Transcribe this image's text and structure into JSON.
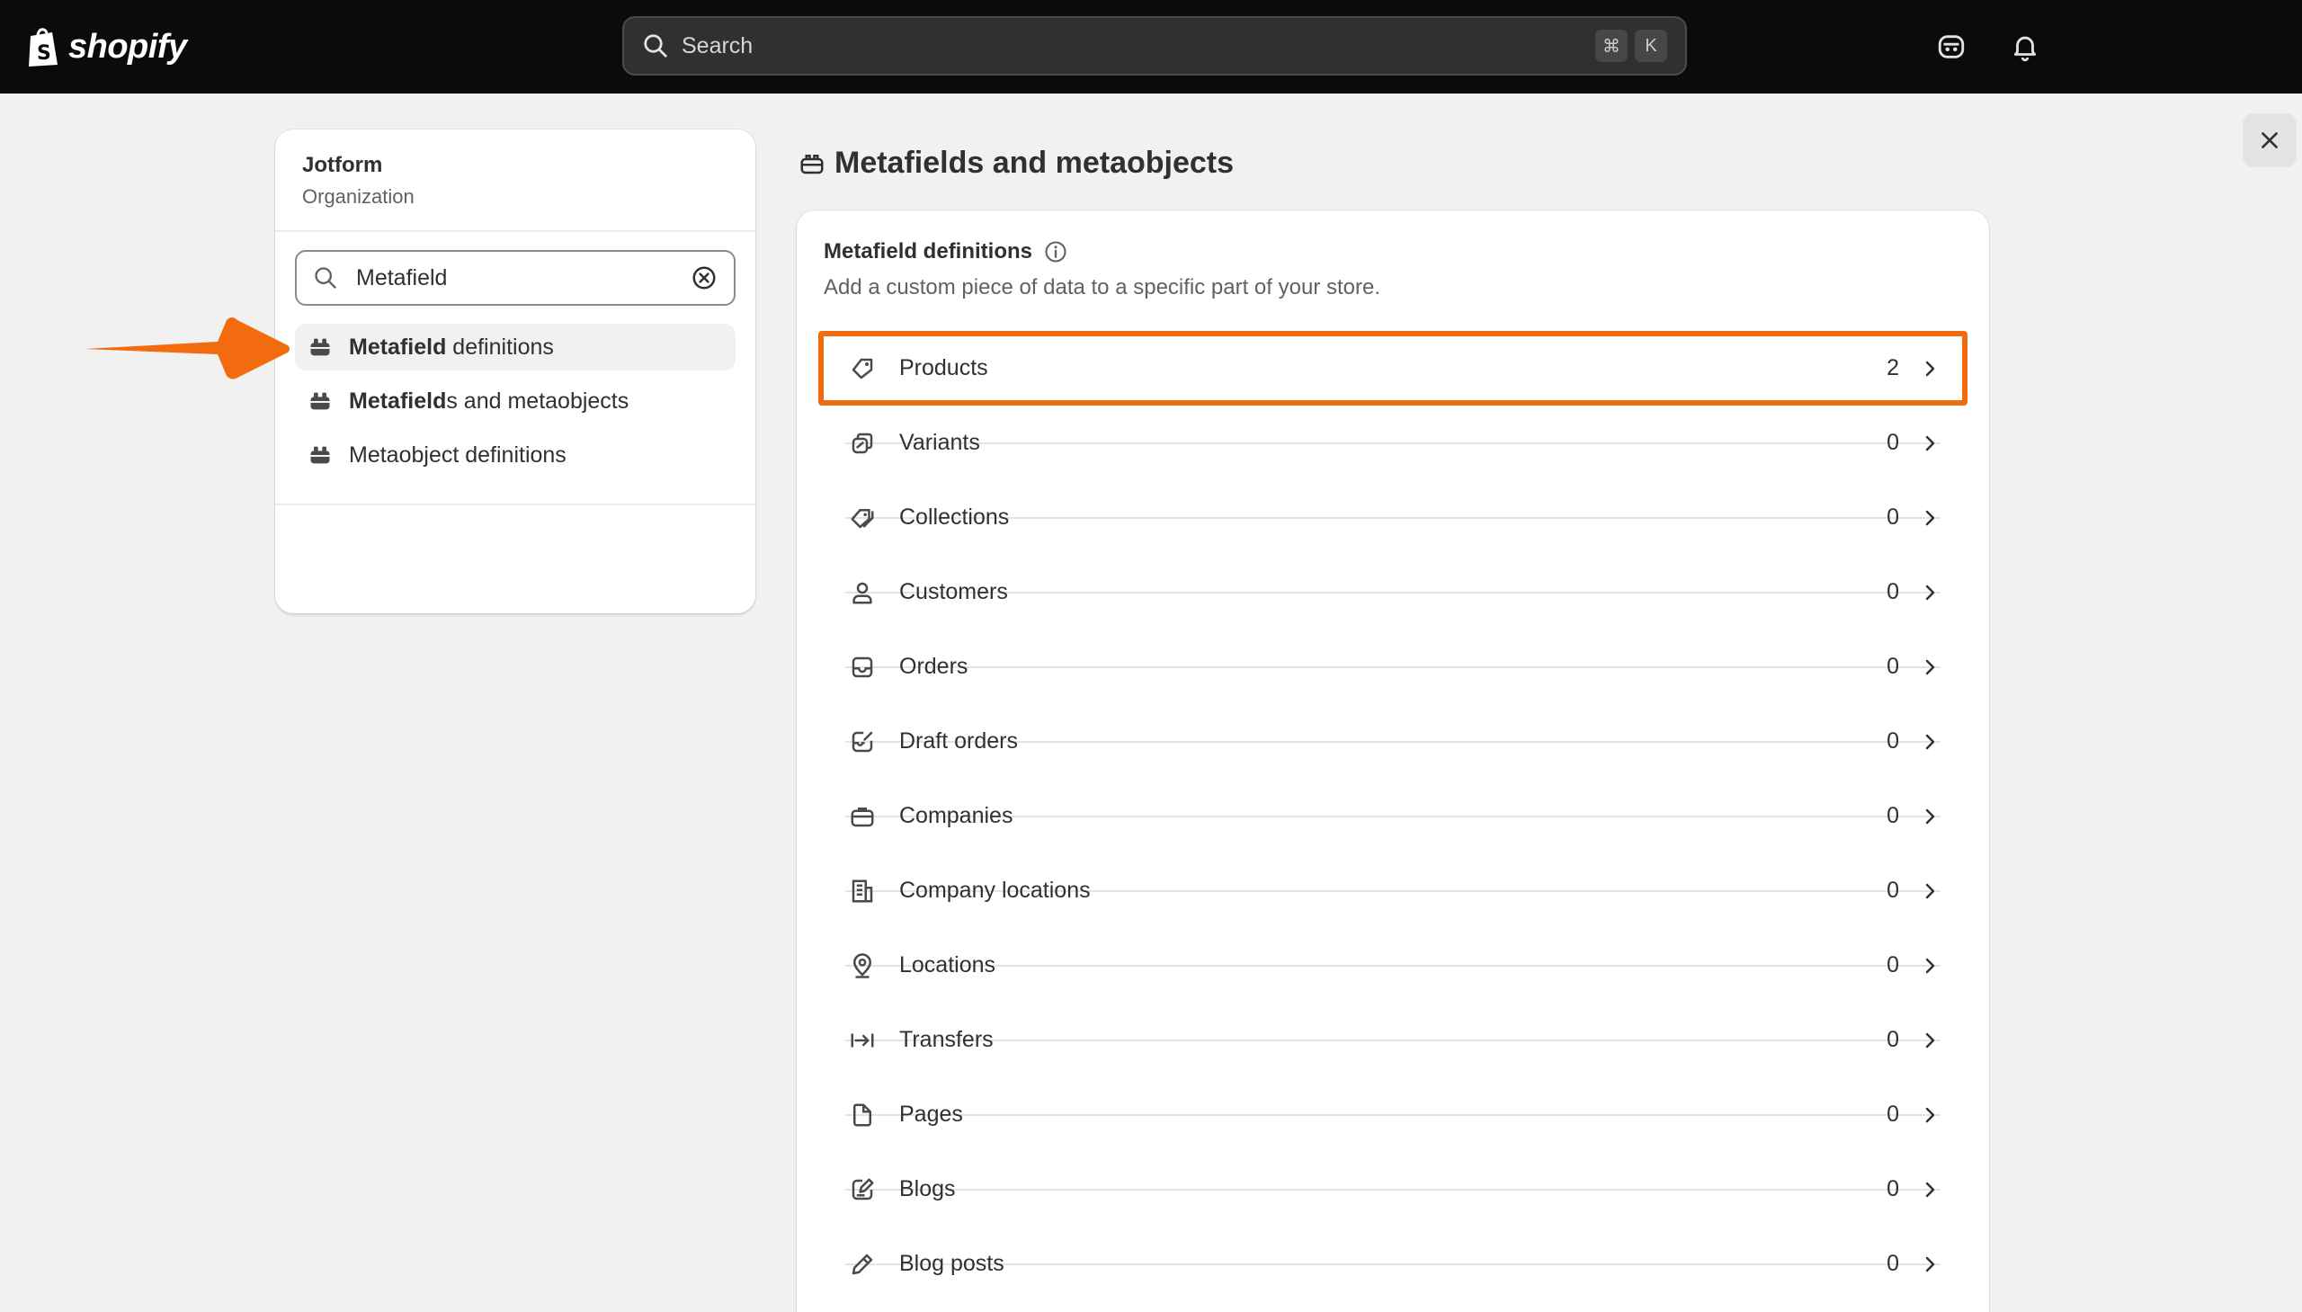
{
  "topbar": {
    "logo_text": "shopify",
    "search_placeholder": "Search",
    "shortcut_keys": [
      "⌘",
      "K"
    ]
  },
  "left_panel": {
    "org_name": "Jotform",
    "org_sub": "Organization",
    "search_value": "Metafield",
    "items": [
      {
        "bold": "Metafield",
        "rest": " definitions",
        "active": true
      },
      {
        "bold": "Metafield",
        "rest": "s and metaobjects",
        "active": false
      },
      {
        "bold": "",
        "rest": "Metaobject definitions",
        "active": false
      }
    ]
  },
  "main": {
    "page_title": "Metafields and metaobjects",
    "card_title": "Metafield definitions",
    "card_desc": "Add a custom piece of data to a specific part of your store.",
    "rows": [
      {
        "label": "Products",
        "count": "2",
        "icon": "tag-icon"
      },
      {
        "label": "Variants",
        "count": "0",
        "icon": "variants-icon"
      },
      {
        "label": "Collections",
        "count": "0",
        "icon": "collections-icon"
      },
      {
        "label": "Customers",
        "count": "0",
        "icon": "person-icon"
      },
      {
        "label": "Orders",
        "count": "0",
        "icon": "inbox-icon"
      },
      {
        "label": "Draft orders",
        "count": "0",
        "icon": "draft-order-icon"
      },
      {
        "label": "Companies",
        "count": "0",
        "icon": "briefcase-icon"
      },
      {
        "label": "Company locations",
        "count": "0",
        "icon": "building-icon"
      },
      {
        "label": "Locations",
        "count": "0",
        "icon": "location-pin-icon"
      },
      {
        "label": "Transfers",
        "count": "0",
        "icon": "transfer-icon"
      },
      {
        "label": "Pages",
        "count": "0",
        "icon": "page-icon"
      },
      {
        "label": "Blogs",
        "count": "0",
        "icon": "blog-icon"
      },
      {
        "label": "Blog posts",
        "count": "0",
        "icon": "pencil-icon"
      }
    ]
  },
  "colors": {
    "accent_orange": "#f26c0f",
    "topbar_bg": "#0b0b0b"
  }
}
